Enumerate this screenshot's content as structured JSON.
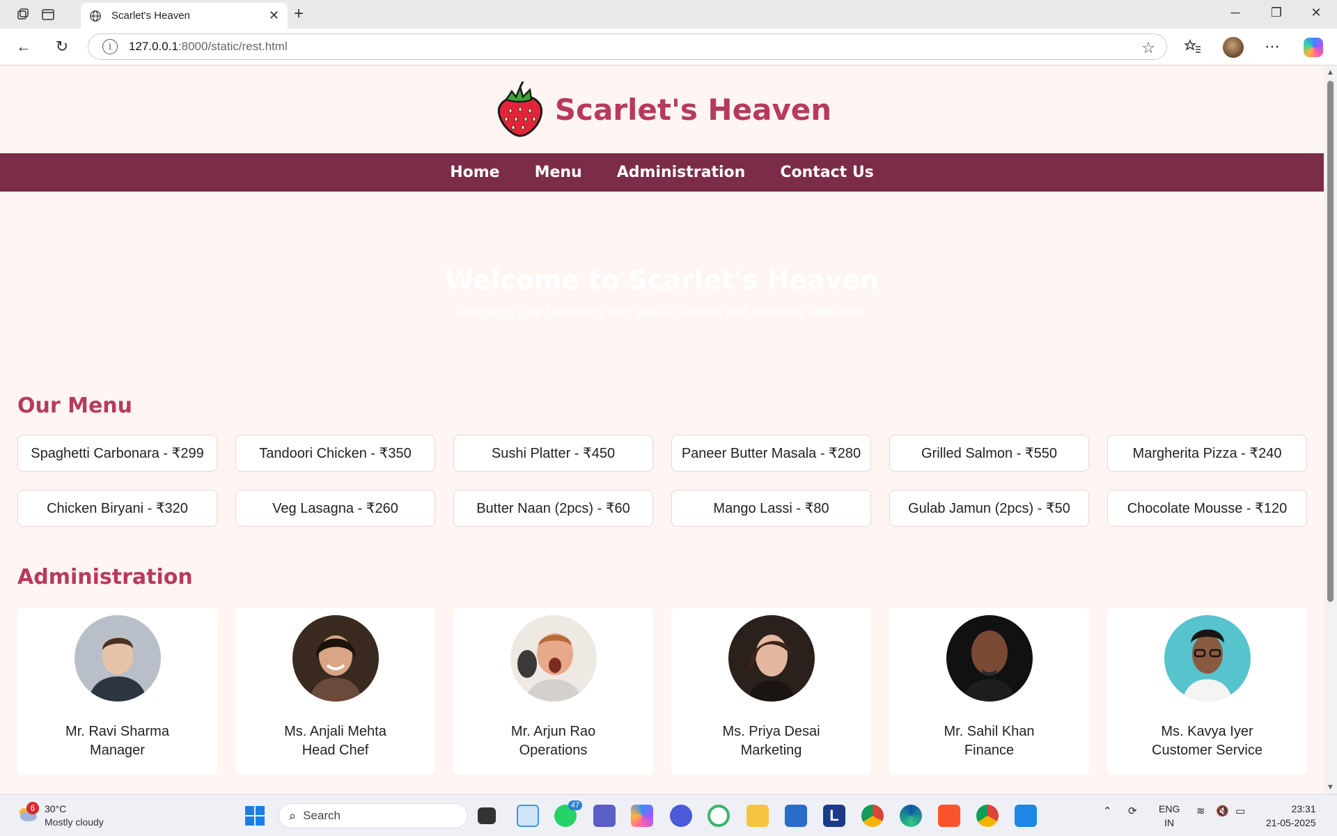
{
  "browser": {
    "tab_title": "Scarlet's Heaven",
    "url_host": "127.0.0.1",
    "url_path": ":8000/static/rest.html"
  },
  "site": {
    "brand": "Scarlet's Heaven",
    "nav": [
      "Home",
      "Menu",
      "Administration",
      "Contact Us"
    ],
    "hero_title": "Welcome to Scarlet's Heaven",
    "hero_subtitle": "Delighting your tastebuds with global cuisines and heavenly ambiance.",
    "menu_title": "Our Menu",
    "menu_items": [
      "Spaghetti Carbonara - ₹299",
      "Tandoori Chicken - ₹350",
      "Sushi Platter - ₹450",
      "Paneer Butter Masala - ₹280",
      "Grilled Salmon - ₹550",
      "Margherita Pizza - ₹240",
      "Chicken Biryani - ₹320",
      "Veg Lasagna - ₹260",
      "Butter Naan (2pcs) - ₹60",
      "Mango Lassi - ₹80",
      "Gulab Jamun (2pcs) - ₹50",
      "Chocolate Mousse - ₹120"
    ],
    "admin_title": "Administration",
    "staff": [
      {
        "name": "Mr. Ravi Sharma",
        "role": "Manager"
      },
      {
        "name": "Ms. Anjali Mehta",
        "role": "Head Chef"
      },
      {
        "name": "Mr. Arjun Rao",
        "role": "Operations"
      },
      {
        "name": "Ms. Priya Desai",
        "role": "Marketing"
      },
      {
        "name": "Mr. Sahil Khan",
        "role": "Finance"
      },
      {
        "name": "Ms. Kavya Iyer",
        "role": "Customer Service"
      }
    ]
  },
  "taskbar": {
    "weather_badge": "6",
    "temperature": "30°C",
    "condition": "Mostly cloudy",
    "search_placeholder": "Search",
    "whatsapp_badge": "47",
    "lang_top": "ENG",
    "lang_bottom": "IN",
    "time": "23:31",
    "date": "21-05-2025"
  },
  "colors": {
    "brand": "#b83a5b",
    "navbar": "#7b2c48",
    "page_bg": "#fff5f2"
  }
}
